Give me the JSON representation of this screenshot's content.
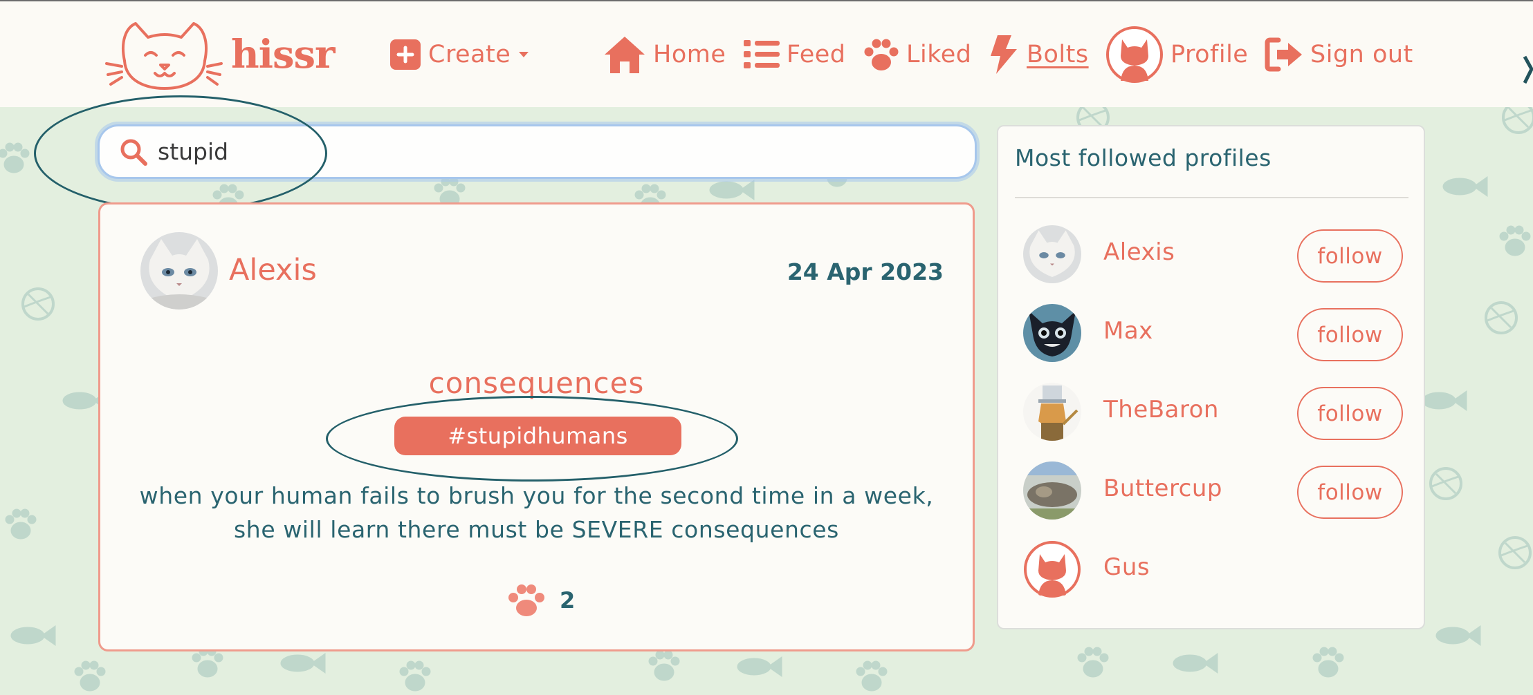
{
  "colors": {
    "accent": "#e8705e",
    "text": "#2a6470",
    "background": "#e3efdf"
  },
  "nav": {
    "brand": "hissr",
    "create": "Create",
    "home": "Home",
    "feed": "Feed",
    "liked": "Liked",
    "bolts": "Bolts",
    "profile": "Profile",
    "sign_out": "Sign out"
  },
  "search": {
    "value": "stupid",
    "icon": "search-icon"
  },
  "post": {
    "author": "Alexis",
    "date": "24 Apr 2023",
    "title": "consequences",
    "hashtag": "#stupidhumans",
    "body_line1": "when your human fails to brush you for the second time in a week,",
    "body_line2": "she will learn there must be SEVERE consequences",
    "likes": "2"
  },
  "sidebar": {
    "title": "Most followed profiles",
    "follow_label": "follow",
    "profiles": [
      {
        "name": "Alexis"
      },
      {
        "name": "Max"
      },
      {
        "name": "TheBaron"
      },
      {
        "name": "Buttercup"
      },
      {
        "name": "Gus"
      }
    ]
  }
}
